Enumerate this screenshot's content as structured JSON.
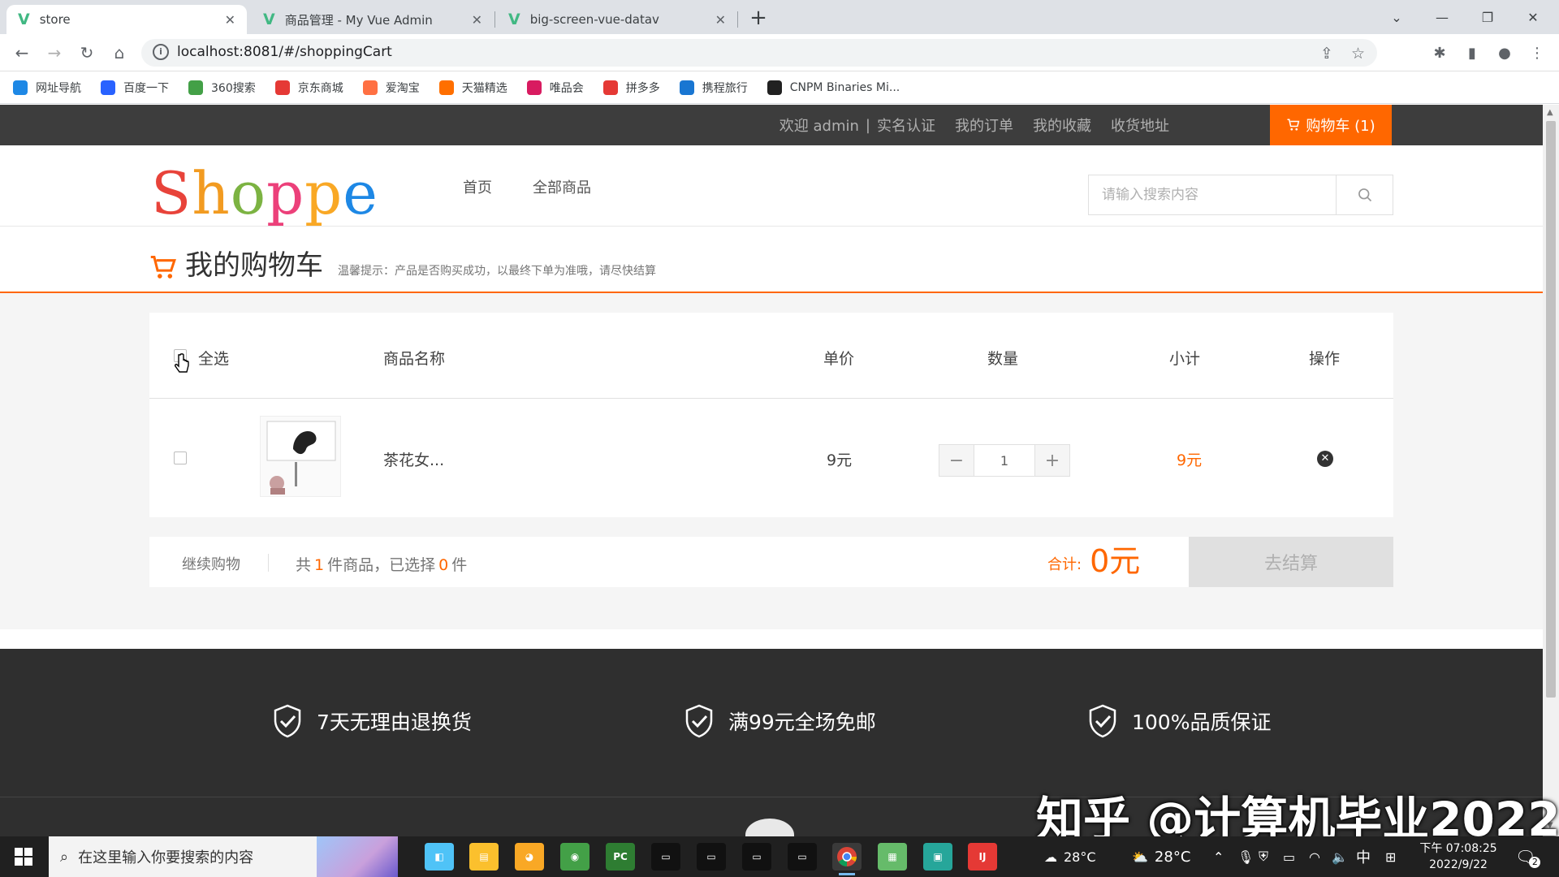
{
  "browser": {
    "tabs": [
      {
        "title": "store"
      },
      {
        "title": "商品管理 - My Vue Admin"
      },
      {
        "title": "big-screen-vue-datav"
      }
    ],
    "url": "localhost:8081/#/shoppingCart",
    "bookmarks": [
      {
        "label": "网址导航",
        "color": "#1e88e5"
      },
      {
        "label": "百度一下",
        "color": "#2962ff"
      },
      {
        "label": "360搜索",
        "color": "#43a047"
      },
      {
        "label": "京东商城",
        "color": "#e53935"
      },
      {
        "label": "爱淘宝",
        "color": "#ff7043"
      },
      {
        "label": "天猫精选",
        "color": "#ff6f00"
      },
      {
        "label": "唯品会",
        "color": "#d81b60"
      },
      {
        "label": "拼多多",
        "color": "#e53935"
      },
      {
        "label": "携程旅行",
        "color": "#1976d2"
      },
      {
        "label": "CNPM Binaries Mi...",
        "color": "#212121"
      }
    ]
  },
  "topnav": {
    "welcome": "欢迎 admin",
    "divider": "|",
    "realname": "实名认证",
    "orders": "我的订单",
    "favorites": "我的收藏",
    "address": "收货地址",
    "cart": "购物车 (1)"
  },
  "header": {
    "logo_letters": [
      {
        "ch": "S",
        "color": "#e8433a"
      },
      {
        "ch": "h",
        "color": "#f29b21"
      },
      {
        "ch": "o",
        "color": "#7cb342"
      },
      {
        "ch": "p",
        "color": "#ec407a"
      },
      {
        "ch": "p",
        "color": "#f9a825"
      },
      {
        "ch": "e",
        "color": "#1e88e5"
      }
    ],
    "nav": [
      "首页",
      "全部商品"
    ],
    "search_placeholder": "请输入搜索内容"
  },
  "cart": {
    "title": "我的购物车",
    "tip": "温馨提示：产品是否购买成功，以最终下单为准哦，请尽快结算",
    "columns": {
      "select_all": "全选",
      "name": "商品名称",
      "price": "单价",
      "quantity": "数量",
      "subtotal": "小计",
      "action": "操作"
    },
    "items": [
      {
        "name": "茶花女...",
        "price": "9元",
        "quantity": "1",
        "subtotal": "9元"
      }
    ],
    "continue": "继续购物",
    "summary_prefix": "共",
    "total_count": "1",
    "summary_mid": "件商品，已选择",
    "selected_count": "0",
    "summary_suffix": "件",
    "total_label": "合计:",
    "total_value": "0元",
    "checkout": "去结算"
  },
  "footer": {
    "features": [
      "7天无理由退换货",
      "满99元全场免邮",
      "100%品质保证"
    ]
  },
  "watermark": "知乎 @计算机毕业2022",
  "taskbar": {
    "search_placeholder": "在这里输入你要搜索的内容",
    "weather1": "28°C",
    "weather2": "28°C",
    "ime": "中",
    "time": "下午 07:08:25",
    "date": "2022/9/22",
    "notifications": "2"
  },
  "colors": {
    "accent": "#ff6700",
    "topnav_bg": "#3d3d3d",
    "footer_bg": "#2f2f2f"
  }
}
